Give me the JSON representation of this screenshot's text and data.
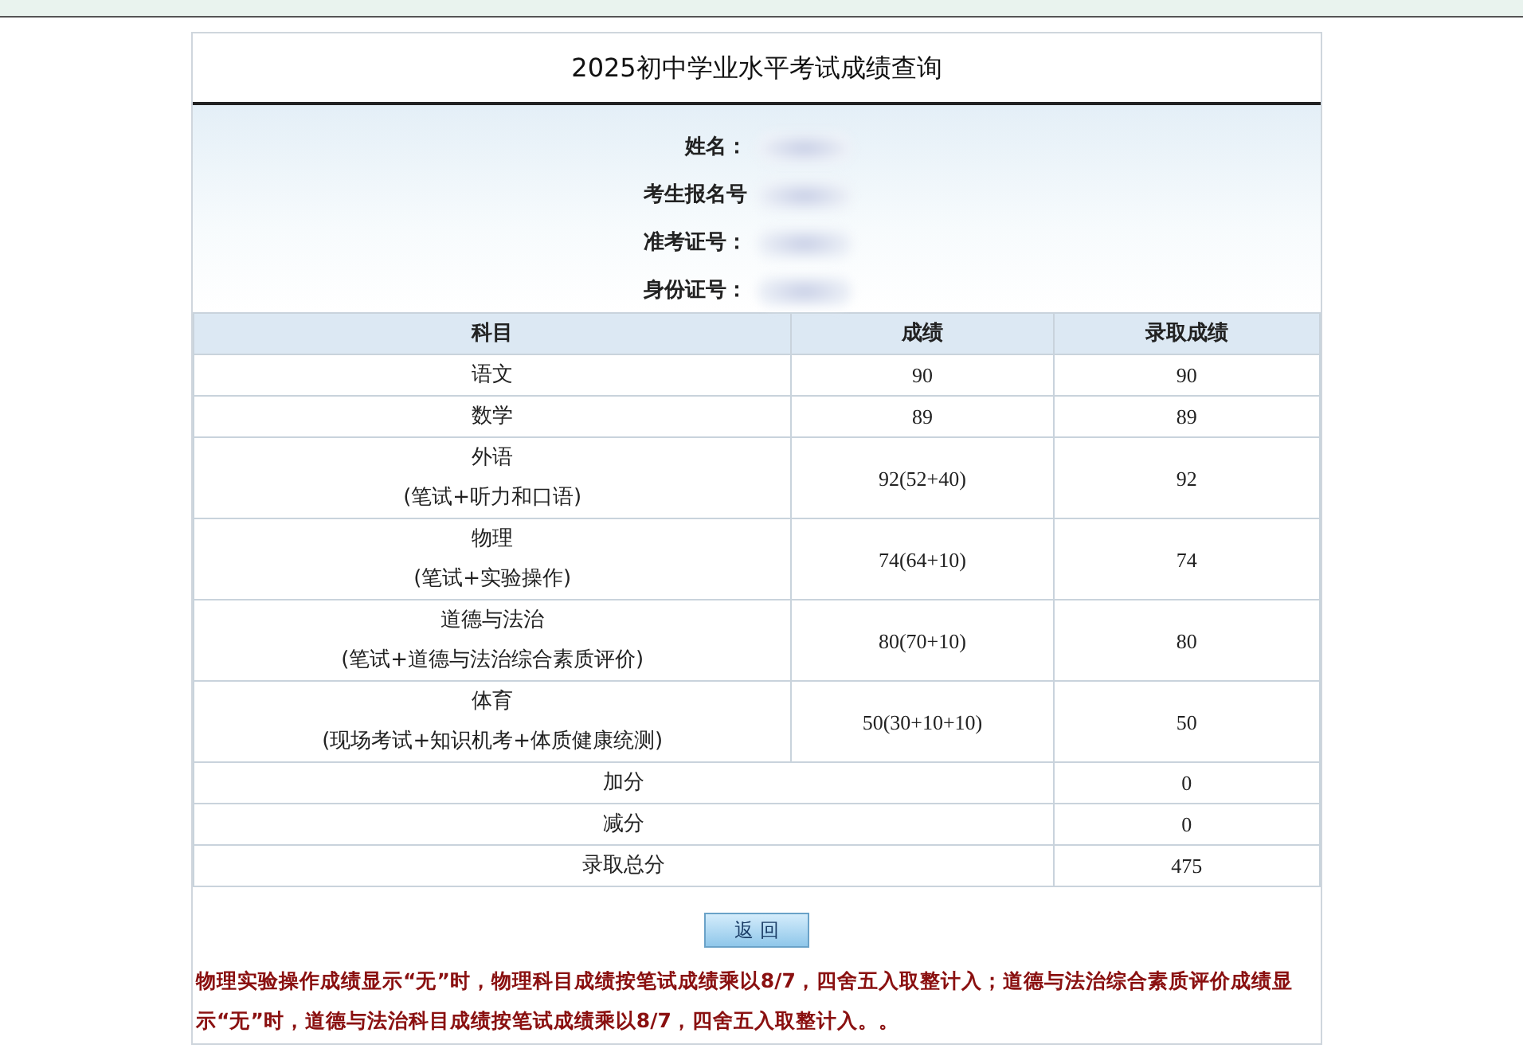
{
  "page_title": "2025初中学业水平考试成绩查询",
  "student_info": [
    {
      "label": "姓名："
    },
    {
      "label": "考生报名号"
    },
    {
      "label": "准考证号："
    },
    {
      "label": "身份证号："
    }
  ],
  "table": {
    "columns": [
      "科目",
      "成绩",
      "录取成绩"
    ],
    "rows": [
      {
        "subject": "语文",
        "score": "90",
        "admitted": "90"
      },
      {
        "subject": "数学",
        "score": "89",
        "admitted": "89"
      },
      {
        "subject": "外语",
        "detail": "(笔试+听力和口语)",
        "score": "92(52+40)",
        "admitted": "92"
      },
      {
        "subject": "物理",
        "detail": "(笔试+实验操作)",
        "score": "74(64+10)",
        "admitted": "74"
      },
      {
        "subject": "道德与法治",
        "detail": "(笔试+道德与法治综合素质评价)",
        "score": "80(70+10)",
        "admitted": "80"
      },
      {
        "subject": "体育",
        "detail": "(现场考试+知识机考+体质健康统测)",
        "score": "50(30+10+10)",
        "admitted": "50"
      }
    ],
    "summary_rows": [
      {
        "label": "加分",
        "value": "0"
      },
      {
        "label": "减分",
        "value": "0"
      },
      {
        "label": "录取总分",
        "value": "475"
      }
    ]
  },
  "back_button": "返 回",
  "note": "物理实验操作成绩显示“无”时，物理科目成绩按笔试成绩乘以8/7，四舍五入取整计入；道德与法治综合素质评价成绩显示“无”时，道德与法治科目成绩按笔试成绩乘以8/7，四舍五入取整计入。。"
}
